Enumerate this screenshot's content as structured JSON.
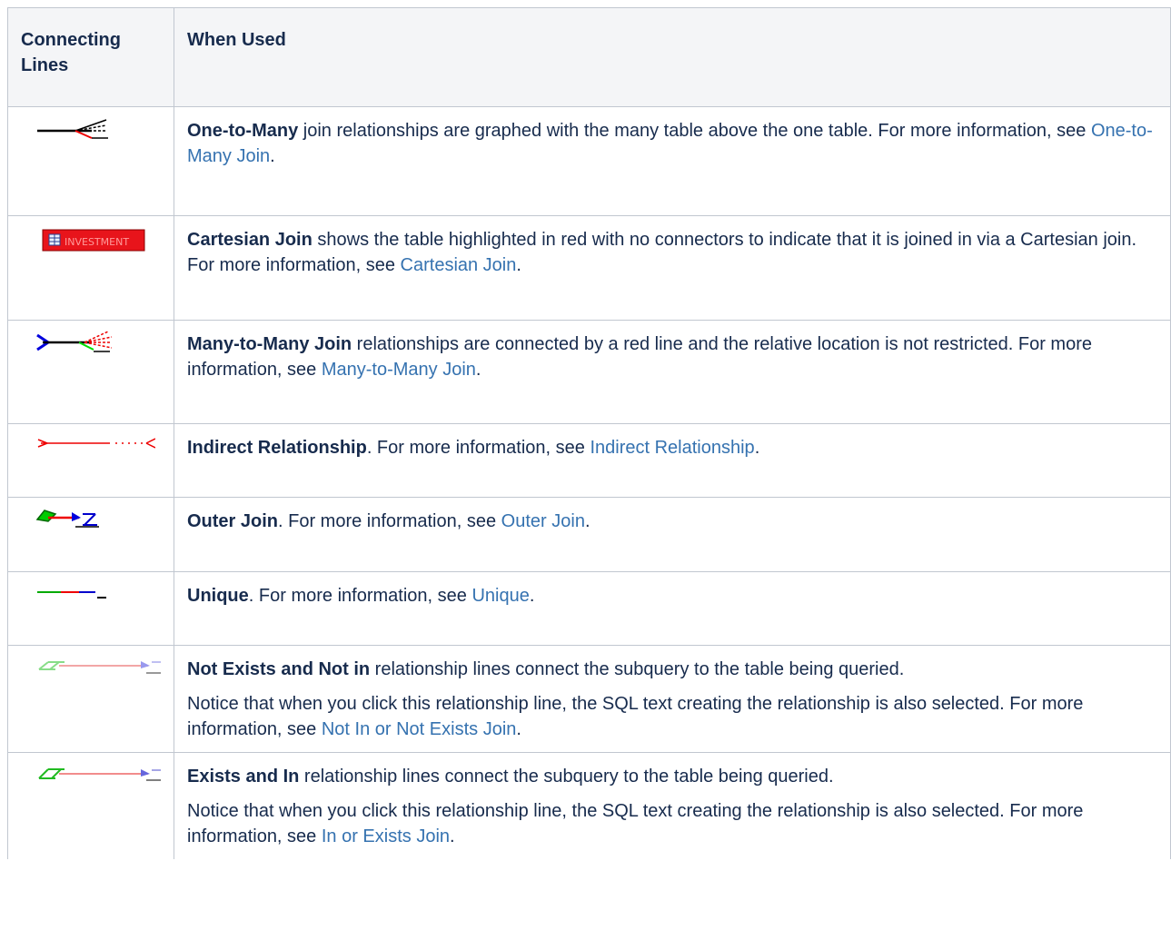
{
  "headers": {
    "col1": "Connecting Lines",
    "col2": "When Used"
  },
  "rows": [
    {
      "icon": "one-to-many-line-icon",
      "term": "One-to-Many",
      "text": " join relationships are graphed with the many table above the one table. For more information, see ",
      "link": "One-to-Many Join",
      "tail": "."
    },
    {
      "icon": "cartesian-table-icon",
      "icon_label": "INVESTMENT",
      "term": "Cartesian Join",
      "text": " shows the table highlighted in red with no connectors to indicate that it is joined in via a Cartesian join. For more information, see ",
      "link": "Cartesian Join",
      "tail": "."
    },
    {
      "icon": "many-to-many-line-icon",
      "term": "Many-to-Many Join",
      "text": " relationships are connected by a red line and the relative location is not restricted. For more information, see ",
      "link": "Many-to-Many Join",
      "tail": "."
    },
    {
      "icon": "indirect-relationship-line-icon",
      "term": "Indirect Relationship",
      "text": ". For more information, see ",
      "link": "Indirect Relationship",
      "tail": "."
    },
    {
      "icon": "outer-join-line-icon",
      "term": "Outer Join",
      "text": ". For more information, see ",
      "link": "Outer Join",
      "tail": "."
    },
    {
      "icon": "unique-line-icon",
      "term": "Unique",
      "text": ". For more information, see ",
      "link": "Unique",
      "tail": "."
    },
    {
      "icon": "not-exists-line-icon",
      "term": "Not Exists and Not in",
      "text": " relationship lines connect the subquery to the table being queried.",
      "note": "Notice that when you click this relationship line, the SQL text creating the relationship is also selected. For more information, see ",
      "link": "Not In or Not Exists Join",
      "tail": "."
    },
    {
      "icon": "exists-line-icon",
      "term": "Exists and In",
      "text": " relationship lines connect the subquery to the table being queried.",
      "note": "Notice that when you click this relationship line, the SQL text creating the relationship is also selected. For more information, see ",
      "link": "In or Exists Join",
      "tail": "."
    }
  ],
  "colors": {
    "link": "#3572b0",
    "header_bg": "#f4f5f7",
    "border": "#c1c7d0",
    "cartesian_red": "#e8141b"
  }
}
